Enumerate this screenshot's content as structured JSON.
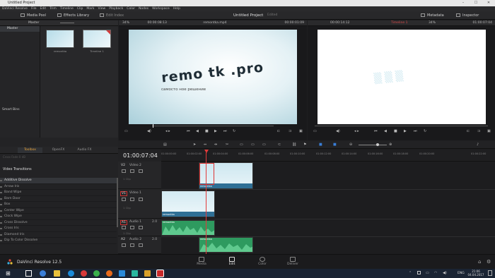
{
  "window": {
    "title": "Untitled Project"
  },
  "menu": [
    "DaVinci Resolve",
    "File",
    "Edit",
    "Trim",
    "Timeline",
    "Clip",
    "Mark",
    "View",
    "Playback",
    "Color",
    "Nodes",
    "Workspace",
    "Help"
  ],
  "topbar": {
    "media_pool": "Media Pool",
    "effects_library": "Effects Library",
    "edit_index": "Edit Index",
    "project_title": "Untitled Project",
    "edited": "Edited",
    "metadata": "Metadata",
    "inspector": "Inspector"
  },
  "media": {
    "master_label": "Master",
    "bin_master": "Master",
    "smart_bins": "Smart Bins",
    "thumbs": [
      {
        "label": "remontka"
      },
      {
        "label": "Timeline 1"
      }
    ]
  },
  "effects": {
    "tabs": [
      "Toolbox",
      "OpenFX",
      "Audio FX"
    ],
    "cross_fade": "Cross Fade 0 dB",
    "section": "Video Transitions",
    "items": [
      "Additive Dissolve",
      "Arrow Iris",
      "Band Wipe",
      "Barn Door",
      "Box",
      "Center Wipe",
      "Clock Wipe",
      "Cross Dissolve",
      "Cross Iris",
      "Diamond Iris",
      "Dip To Color Dissolve"
    ]
  },
  "source_viewer": {
    "zoom": "34%",
    "timecode_left": "00:00:08:13",
    "clip_name": "remontka.mp4",
    "timecode_right": "00:00:01:09",
    "overlay_big": "remo tk .pro",
    "overlay_sub": "самосто     ное решение"
  },
  "timeline_viewer": {
    "timecode": "00:00:14:12",
    "timeline_name": "Timeline 1",
    "zoom": "34%",
    "timecode_right": "01:00:07:04"
  },
  "timeline": {
    "timecode": "01:00:07:04",
    "ruler": [
      "01:00:00:00",
      "01:00:02:00",
      "01:00:04:00",
      "01:00:06:00",
      "01:00:08:00",
      "01:00:10:00",
      "01:00:12:00",
      "01:00:14:00",
      "01:00:16:00",
      "01:00:18:00",
      "01:00:20:00",
      "01:00:22:00"
    ],
    "tracks": [
      {
        "id": "V2",
        "name": "Video 2",
        "count": "1 Clip"
      },
      {
        "id": "V1",
        "name": "Video 1",
        "count": "1 Clip"
      },
      {
        "id": "A1",
        "name": "Audio 1",
        "num": "2.0",
        "count": "1 Clip"
      },
      {
        "id": "A2",
        "name": "Audio 2",
        "num": "2.0",
        "count": ""
      }
    ],
    "clip_label": "remontka"
  },
  "pages": [
    "Media",
    "Edit",
    "Color",
    "Deliver"
  ],
  "app": {
    "name": "DaVinci Resolve 12.5"
  },
  "taskbar": {
    "lang": "ENG",
    "time": "21:06",
    "date": "04.04.2017"
  },
  "colors": {
    "accent": "#e8a33a",
    "clip_video": "#2f6f95",
    "clip_audio": "#2e9a5f",
    "playhead": "#e33a3a",
    "active_page": "#e04040"
  }
}
